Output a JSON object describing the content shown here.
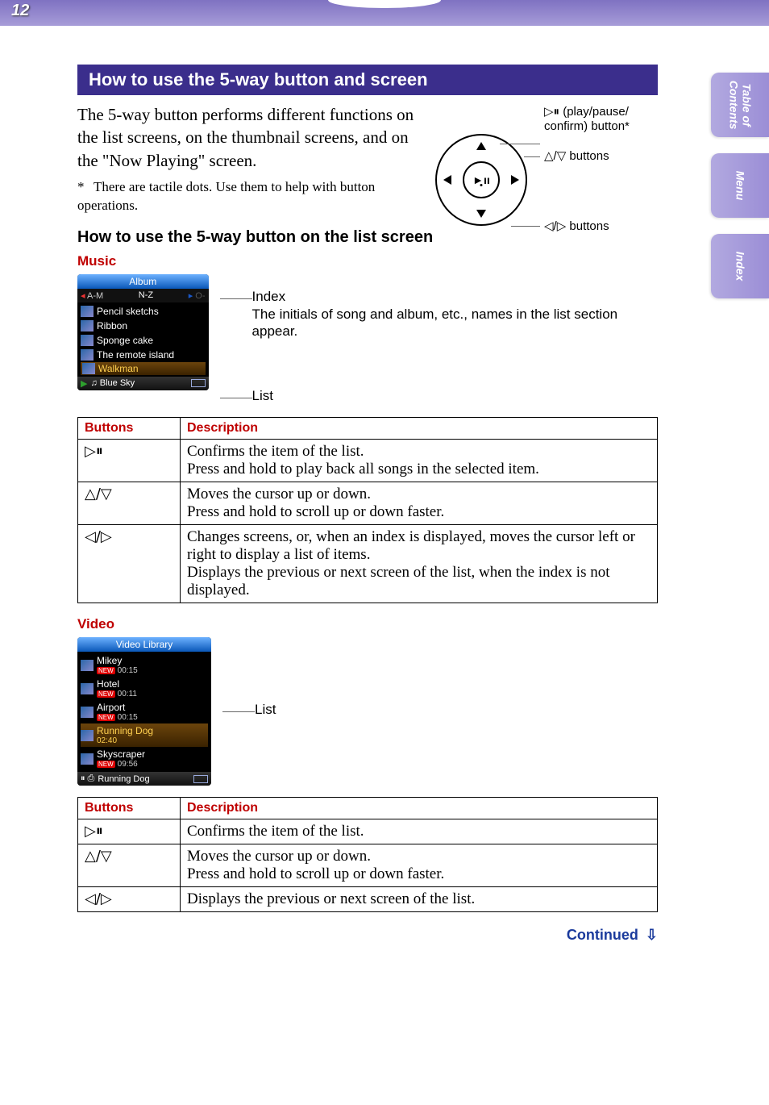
{
  "page_number": "12",
  "side_tabs": [
    "Table of\nContents",
    "Menu",
    "Index"
  ],
  "section_title": "How to use the 5-way button and screen",
  "intro": "The 5-way button performs different functions on the list screens, on the thumbnail screens, and on the \"Now Playing\" screen.",
  "star_note": "There are tactile dots. Use them to help with button operations.",
  "star_symbol": "*",
  "diagram": {
    "center_glyph": "►ıı",
    "label_play": "▷⏸ (play/pause/\nconfirm) button*",
    "label_ud": "△/▽ buttons",
    "label_lr": "◁/▷ buttons"
  },
  "subheading": "How to use the 5-way button on the list screen",
  "music": {
    "heading": "Music",
    "screen_title": "Album",
    "index_row": {
      "left": "A-M",
      "mid": "N-Z",
      "right": "O-"
    },
    "items": [
      "Pencil sketchs",
      "Ribbon",
      "Sponge cake",
      "The remote island",
      "Walkman"
    ],
    "highlight_index": 4,
    "now_playing": "♫ Blue Sky",
    "annot_index_title": "Index",
    "annot_index_desc": "The initials of song and album, etc., names in the list section appear.",
    "annot_list": "List"
  },
  "table_music": {
    "head": {
      "buttons": "Buttons",
      "desc": "Description"
    },
    "rows": [
      {
        "btn": "▷⏸",
        "desc": "Confirms the item of the list.\nPress and hold to play back all songs in the selected item."
      },
      {
        "btn": "△/▽",
        "desc": "Moves the cursor up or down.\nPress and hold to scroll up or down faster."
      },
      {
        "btn": "◁/▷",
        "desc": "Changes screens, or, when an index is displayed, moves the cursor left or right to display a list of items.\nDisplays the previous or next screen of the list, when the index is not displayed."
      }
    ]
  },
  "video": {
    "heading": "Video",
    "screen_title": "Video Library",
    "items": [
      {
        "title": "Mikey",
        "dur": "00:15",
        "new": true
      },
      {
        "title": "Hotel",
        "dur": "00:11",
        "new": true
      },
      {
        "title": "Airport",
        "dur": "00:15",
        "new": true
      },
      {
        "title": "Running Dog",
        "dur": "02:40",
        "new": false
      },
      {
        "title": "Skyscraper",
        "dur": "09:56",
        "new": true
      }
    ],
    "highlight_index": 3,
    "status_prefix": "⏸ ⎙",
    "status_text": "Running Dog",
    "annot_list": "List"
  },
  "table_video": {
    "head": {
      "buttons": "Buttons",
      "desc": "Description"
    },
    "rows": [
      {
        "btn": "▷⏸",
        "desc": "Confirms the item of the list."
      },
      {
        "btn": "△/▽",
        "desc": "Moves the cursor up or down.\nPress and hold to scroll up or down faster."
      },
      {
        "btn": "◁/▷",
        "desc": "Displays the previous or next screen of the list."
      }
    ]
  },
  "continued": "Continued",
  "chart_data": {
    "type": "table",
    "tables": [
      {
        "title": "Music — 5-way button behaviour on list screen",
        "columns": [
          "Buttons",
          "Description"
        ],
        "rows": [
          [
            "▷⏸ (play/pause/confirm)",
            "Confirms the item of the list. Press and hold to play back all songs in the selected item."
          ],
          [
            "△/▽ (up/down)",
            "Moves the cursor up or down. Press and hold to scroll up or down faster."
          ],
          [
            "◁/▷ (left/right)",
            "Changes screens, or, when an index is displayed, moves the cursor left or right to display a list of items. Displays the previous or next screen of the list, when the index is not displayed."
          ]
        ]
      },
      {
        "title": "Video — 5-way button behaviour on list screen",
        "columns": [
          "Buttons",
          "Description"
        ],
        "rows": [
          [
            "▷⏸ (play/pause/confirm)",
            "Confirms the item of the list."
          ],
          [
            "△/▽ (up/down)",
            "Moves the cursor up or down. Press and hold to scroll up or down faster."
          ],
          [
            "◁/▷ (left/right)",
            "Displays the previous or next screen of the list."
          ]
        ]
      }
    ]
  }
}
